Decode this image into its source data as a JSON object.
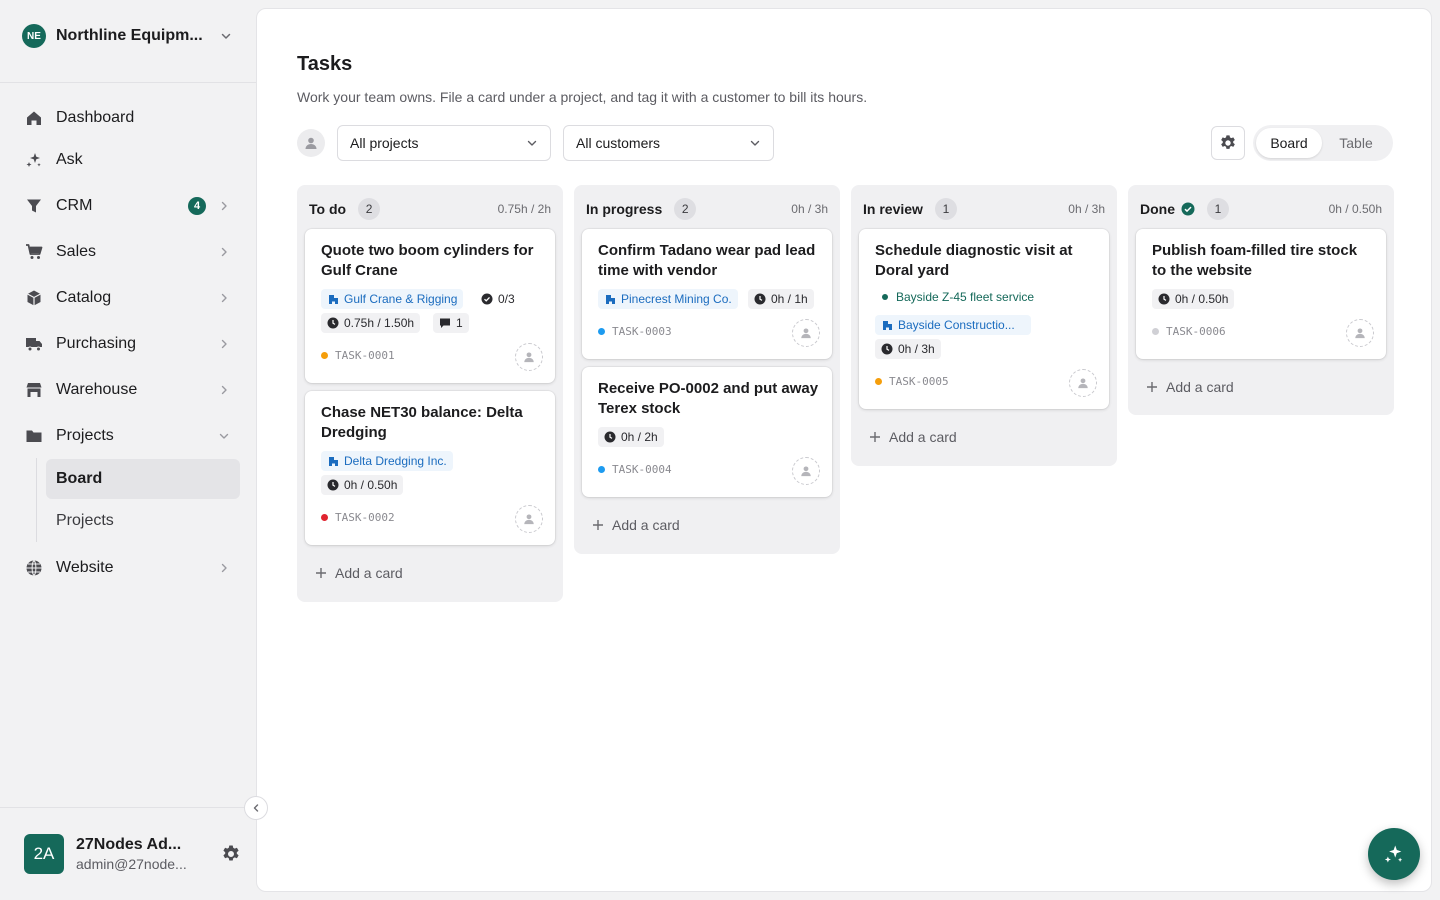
{
  "org": {
    "initials": "NE",
    "name": "Northline Equipm..."
  },
  "nav": {
    "dashboard": "Dashboard",
    "ask": "Ask",
    "crm": "CRM",
    "crm_badge": "4",
    "sales": "Sales",
    "catalog": "Catalog",
    "purchasing": "Purchasing",
    "warehouse": "Warehouse",
    "projects": "Projects",
    "projects_sub": [
      "Board",
      "Projects"
    ],
    "website": "Website"
  },
  "user": {
    "initials": "2A",
    "name": "27Nodes Ad...",
    "email": "admin@27node..."
  },
  "page": {
    "title": "Tasks",
    "subtitle": "Work your team owns. File a card under a project, and tag it with a customer to bill its hours."
  },
  "filters": {
    "projects": "All projects",
    "customers": "All customers"
  },
  "view_toggle": {
    "board": "Board",
    "table": "Table",
    "active": "Board"
  },
  "add_card_label": "Add a card",
  "colors": {
    "brand": "#15695a",
    "customer_chip": "#1b6cbf",
    "priority_orange": "#f59e0b",
    "priority_red": "#e0242f",
    "priority_blue": "#1d9bf0",
    "priority_gray": "#d0d0d5"
  },
  "columns": [
    {
      "title": "To do",
      "count": "2",
      "hours": "0.75h / 2h",
      "cards": [
        {
          "title": "Quote two boom cylinders for Gulf Crane",
          "customer": "Gulf Crane & Rigging",
          "checklist": "0/3",
          "time": "0.75h / 1.50h",
          "comments": "1",
          "id": "TASK-0001",
          "priority_color": "#f59e0b",
          "icon": "building-icon"
        },
        {
          "title": "Chase NET30 balance: Delta Dredging",
          "customer": "Delta Dredging Inc.",
          "time": "0h / 0.50h",
          "id": "TASK-0002",
          "priority_color": "#e0242f"
        }
      ]
    },
    {
      "title": "In progress",
      "count": "2",
      "hours": "0h / 3h",
      "cards": [
        {
          "title": "Confirm Tadano wear pad lead time with vendor",
          "customer": "Pinecrest Mining Co.",
          "time": "0h / 1h",
          "id": "TASK-0003",
          "priority_color": "#1d9bf0"
        },
        {
          "title": "Receive PO-0002 and put away Terex stock",
          "time": "0h / 2h",
          "id": "TASK-0004",
          "priority_color": "#1d9bf0"
        }
      ]
    },
    {
      "title": "In review",
      "count": "1",
      "hours": "0h / 3h",
      "cards": [
        {
          "title": "Schedule diagnostic visit at Doral yard",
          "project": "Bayside Z-45 fleet service",
          "customer": "Bayside Constructio...",
          "time": "0h / 3h",
          "id": "TASK-0005",
          "priority_color": "#f59e0b"
        }
      ]
    },
    {
      "title": "Done",
      "count": "1",
      "hours": "0h / 0.50h",
      "done": true,
      "cards": [
        {
          "title": "Publish foam-filled tire stock to the website",
          "time": "0h / 0.50h",
          "id": "TASK-0006",
          "priority_color": "#d0d0d5"
        }
      ]
    }
  ]
}
